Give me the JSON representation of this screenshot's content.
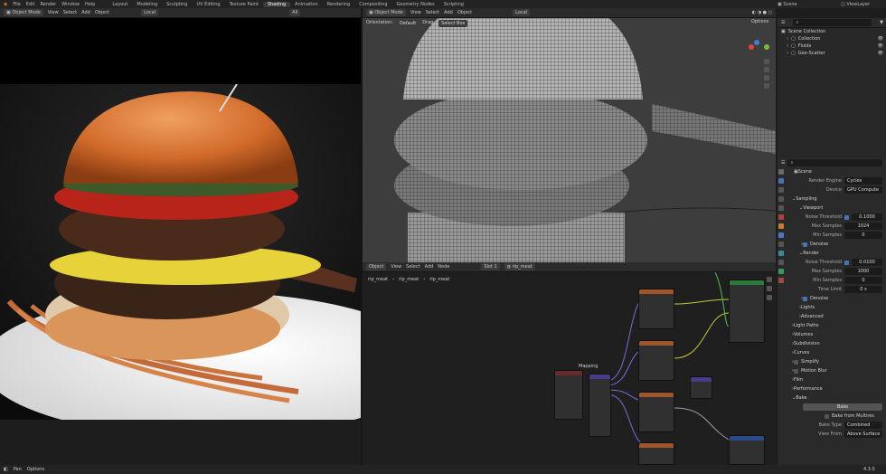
{
  "menu": {
    "items": [
      "File",
      "Edit",
      "Render",
      "Window",
      "Help"
    ]
  },
  "workspaces": [
    "Layout",
    "Modeling",
    "Sculpting",
    "UV Editing",
    "Texture Paint",
    "Shading",
    "Animation",
    "Rendering",
    "Compositing",
    "Geometry Nodes",
    "Scripting"
  ],
  "active_workspace": "Shading",
  "scene": {
    "name": "Scene",
    "viewlayer": "ViewLayer"
  },
  "left_header": {
    "mode": "Object Mode",
    "view": "View",
    "select": "Select",
    "add": "Add",
    "object": "Object",
    "transform": "Local",
    "all": "All"
  },
  "viewport_header": {
    "mode": "Object Mode",
    "view": "View",
    "select": "Select",
    "add": "Add",
    "object": "Object",
    "transform": "Local",
    "options": "Options"
  },
  "viewport_tools": {
    "orientation_label": "Orientation:",
    "orientation": "Default",
    "drag_label": "Drag:",
    "drag": "Select Box"
  },
  "node_header": {
    "type": "Object",
    "view": "View",
    "select": "Select",
    "add": "Add",
    "node": "Node",
    "slot": "Slot 1",
    "material": "rip_meat"
  },
  "breadcrumb": [
    "rip_meat",
    "rip_meat",
    "rip_meat"
  ],
  "node_labels": {
    "mapping": "Mapping"
  },
  "outliner": {
    "search_placeholder": "",
    "root": "Scene Collection",
    "items": [
      "Collection",
      "Fluids",
      "Geo-Scatter"
    ]
  },
  "properties": {
    "search_placeholder": "",
    "scene_label": "Scene",
    "render_engine_label": "Render Engine",
    "render_engine": "Cycles",
    "device_label": "Device",
    "device": "GPU Compute",
    "sampling": "Sampling",
    "viewport": "Viewport",
    "noise_threshold_label": "Noise Threshold",
    "vp_noise": "0.1000",
    "max_samples_label": "Max Samples",
    "vp_max": "1024",
    "min_samples_label": "Min Samples",
    "vp_min": "0",
    "denoise": "Denoise",
    "render": "Render",
    "r_noise": "0.0100",
    "r_max": "1000",
    "r_min": "0",
    "time_limit_label": "Time Limit",
    "r_time": "0 s",
    "denoise2": "Denoise",
    "lights": "Lights",
    "advanced": "Advanced",
    "sections": [
      "Light Paths",
      "Volumes",
      "Subdivision",
      "Curves",
      "Simplify",
      "Motion Blur",
      "Film",
      "Performance"
    ],
    "bake": "Bake",
    "bake_button": "Bake",
    "bake_multires": "Bake from Multires",
    "bake_type_label": "Bake Type",
    "bake_type": "Combined",
    "view_from_label": "View From",
    "view_from": "Above Surface"
  },
  "statusbar": {
    "left": "Pan",
    "mid": "Options",
    "version": "4.3.0"
  }
}
